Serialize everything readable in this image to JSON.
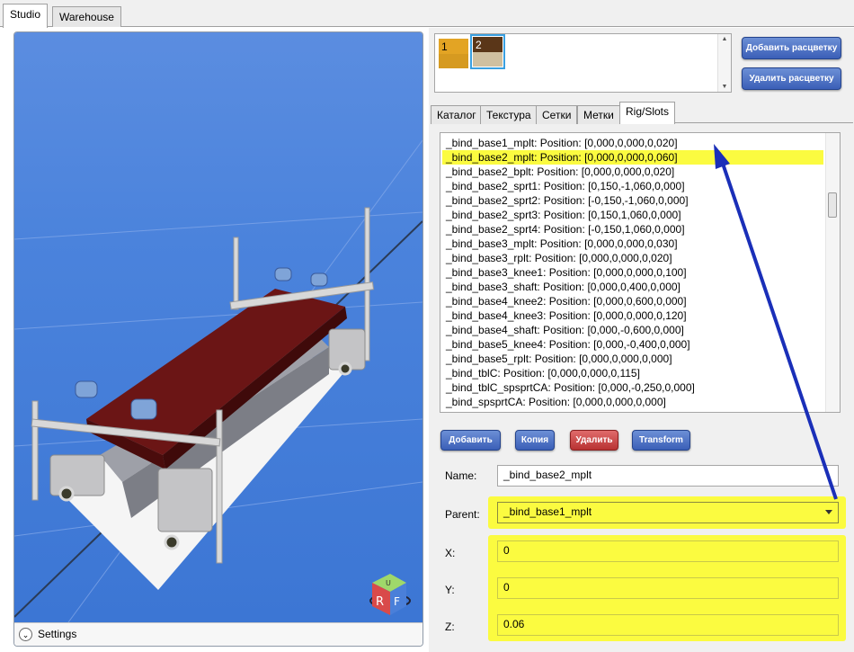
{
  "window": {
    "tabs": [
      {
        "label": "Studio",
        "active": true
      },
      {
        "label": "Warehouse",
        "active": false
      }
    ]
  },
  "viewport": {
    "settings_label": "Settings",
    "gizmo": {
      "label_r": "R",
      "label_f": "F",
      "label_u": "U"
    }
  },
  "palette": {
    "swatches": [
      {
        "number": "1",
        "top_color": "#e3a424",
        "bottom_color": "#d69a20"
      },
      {
        "number": "2",
        "top_color": "#5a3618",
        "bottom_color": "#cfc0a0",
        "selected": true
      }
    ],
    "add_button": "Добавить расцветку",
    "remove_button": "Удалить расцветку"
  },
  "subtabs": [
    {
      "label": "Каталог",
      "active": false
    },
    {
      "label": "Текстура",
      "active": false
    },
    {
      "label": "Сетки",
      "active": false
    },
    {
      "label": "Метки",
      "active": false
    },
    {
      "label": "Rig/Slots",
      "active": true
    }
  ],
  "slots": {
    "selected_index": 1,
    "items": [
      "_bind_base1_mplt: Position: [0,000,0,000,0,020]",
      "_bind_base2_mplt: Position: [0,000,0,000,0,060]",
      "_bind_base2_bplt: Position: [0,000,0,000,0,020]",
      "_bind_base2_sprt1: Position: [0,150,-1,060,0,000]",
      "_bind_base2_sprt2: Position: [-0,150,-1,060,0,000]",
      "_bind_base2_sprt3: Position: [0,150,1,060,0,000]",
      "_bind_base2_sprt4: Position: [-0,150,1,060,0,000]",
      "_bind_base3_mplt: Position: [0,000,0,000,0,030]",
      "_bind_base3_rplt: Position: [0,000,0,000,0,020]",
      "_bind_base3_knee1: Position: [0,000,0,000,0,100]",
      "_bind_base3_shaft: Position: [0,000,0,400,0,000]",
      "_bind_base4_knee2: Position: [0,000,0,600,0,000]",
      "_bind_base4_knee3: Position: [0,000,0,000,0,120]",
      "_bind_base4_shaft: Position: [0,000,-0,600,0,000]",
      "_bind_base5_knee4: Position: [0,000,-0,400,0,000]",
      "_bind_base5_rplt: Position: [0,000,0,000,0,000]",
      "_bind_tblC: Position: [0,000,0,000,0,115]",
      "_bind_tblC_spsprtCA: Position: [0,000,-0,250,0,000]",
      "_bind_spsprtCA: Position: [0,000,0,000,0,000]"
    ]
  },
  "actions": {
    "add": "Добавить",
    "copy": "Копия",
    "delete": "Удалить",
    "transform": "Transform"
  },
  "form": {
    "name_label": "Name:",
    "name_value": "_bind_base2_mplt",
    "parent_label": "Parent:",
    "parent_value": "_bind_base1_mplt",
    "x_label": "X:",
    "x_value": "0",
    "y_label": "Y:",
    "y_value": "0",
    "z_label": "Z:",
    "z_value": "0.06"
  },
  "colors": {
    "highlight": "#fbfb40",
    "arrow": "#1a2fb8",
    "button_blue": "#3b5fb7",
    "button_red": "#b83232"
  }
}
